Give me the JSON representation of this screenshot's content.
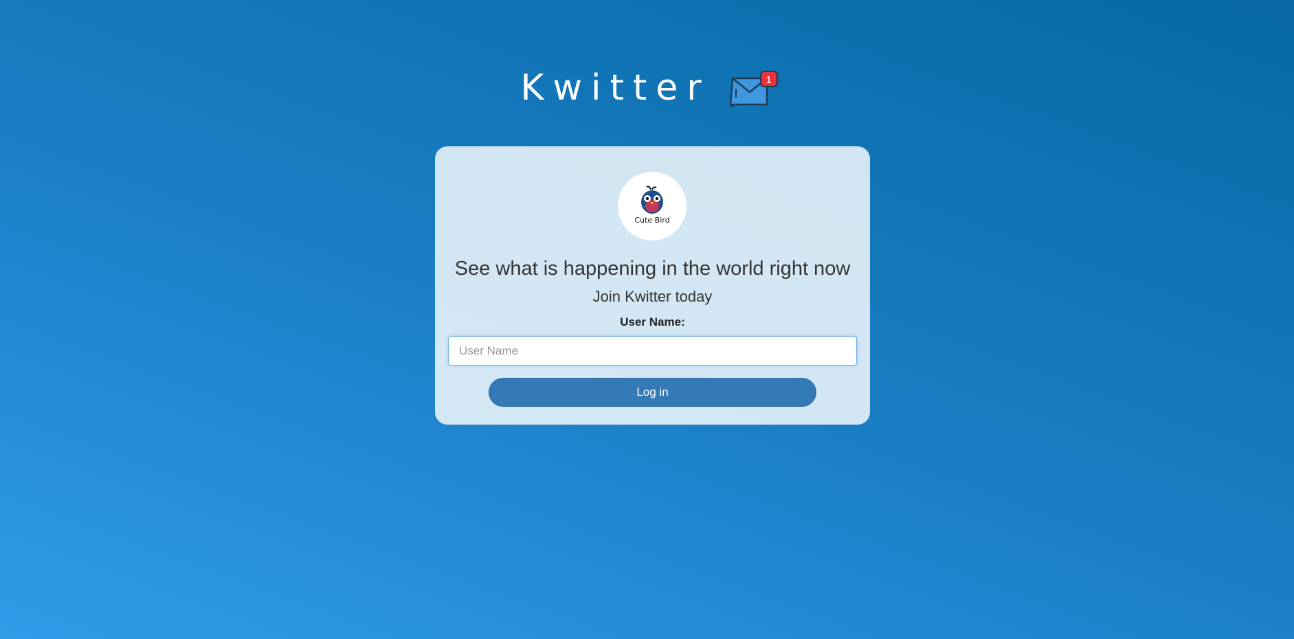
{
  "header": {
    "title": "Kwitter",
    "mail_icon": "envelope-icon",
    "mail_badge_count": "1"
  },
  "card": {
    "avatar_icon": "cute-bird-logo",
    "avatar_label": "Cute Bird",
    "headline": "See what is happening in the world right now",
    "subheadline": "Join Kwitter today",
    "username_label": "User Name:",
    "username_placeholder": "User Name",
    "username_value": "",
    "login_label": "Log in"
  },
  "colors": {
    "background_light": "#2f9ce9",
    "background_dark": "#0768a3",
    "button": "#337ab7",
    "badge": "#e8333a"
  }
}
